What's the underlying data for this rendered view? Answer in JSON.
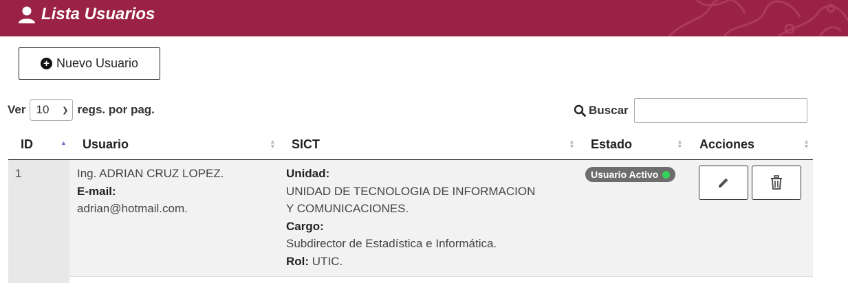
{
  "header": {
    "title": "Lista Usuarios"
  },
  "toolbar": {
    "new_user_label": "Nuevo Usuario"
  },
  "length_control": {
    "prefix": "Ver",
    "selected": "10",
    "suffix": "regs. por pag."
  },
  "search": {
    "label": "Buscar",
    "value": ""
  },
  "table": {
    "columns": [
      "ID",
      "Usuario",
      "SICT",
      "Estado",
      "Acciones"
    ],
    "rows": [
      {
        "id": "1",
        "name": "Ing. ADRIAN CRUZ LOPEZ.",
        "email_label": "E-mail:",
        "email": "adrian@hotmail.com.",
        "unidad_label": "Unidad:",
        "unidad_line1": "UNIDAD DE TECNOLOGIA DE INFORMACION",
        "unidad_line2": "Y COMUNICACIONES.",
        "cargo_label": "Cargo:",
        "cargo": "Subdirector de Estadística e Informática.",
        "rol_label": "Rol:",
        "rol": "UTIC.",
        "status": "Usuario Activo"
      }
    ]
  },
  "colors": {
    "header_bg": "#9b2247",
    "status_dot": "#34d15b",
    "badge_bg": "#6d6d6d"
  },
  "icons": [
    "user-icon",
    "plus-circle-icon",
    "search-icon",
    "chevron-down-icon",
    "pencil-icon",
    "trash-icon",
    "sort-icon"
  ]
}
